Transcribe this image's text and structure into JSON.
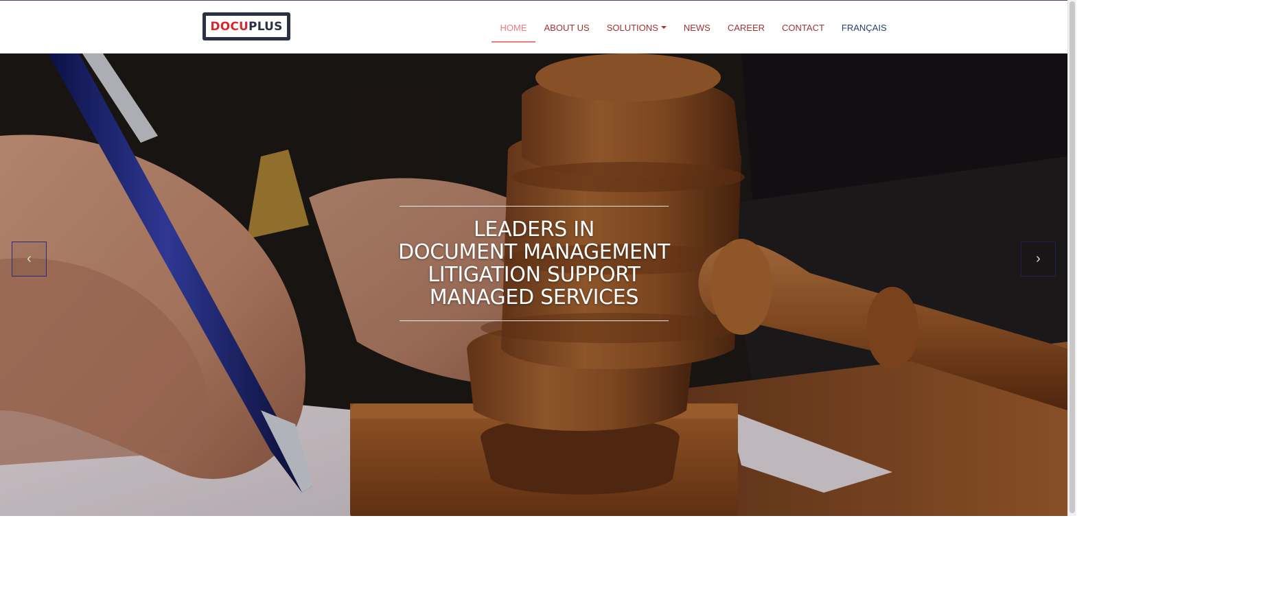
{
  "logo": {
    "part1": "DOCU",
    "part2": "PLUS"
  },
  "nav": {
    "home": "HOME",
    "about": "ABOUT US",
    "solutions": "SOLUTIONS",
    "news": "NEWS",
    "career": "CAREER",
    "contact": "CONTACT",
    "language": "FRANÇAIS"
  },
  "hero": {
    "lines": [
      "LEADERS IN",
      "DOCUMENT MANAGEMENT",
      "LITIGATION SUPPORT",
      "MANAGED SERVICES"
    ],
    "prev_icon": "chevron-left-icon",
    "next_icon": "chevron-right-icon"
  },
  "colors": {
    "nav_link": "#a0332f",
    "nav_active": "#f07a7a",
    "nav_language": "#24406e",
    "logo_red": "#d12a2f",
    "logo_navy": "#2b3045"
  }
}
